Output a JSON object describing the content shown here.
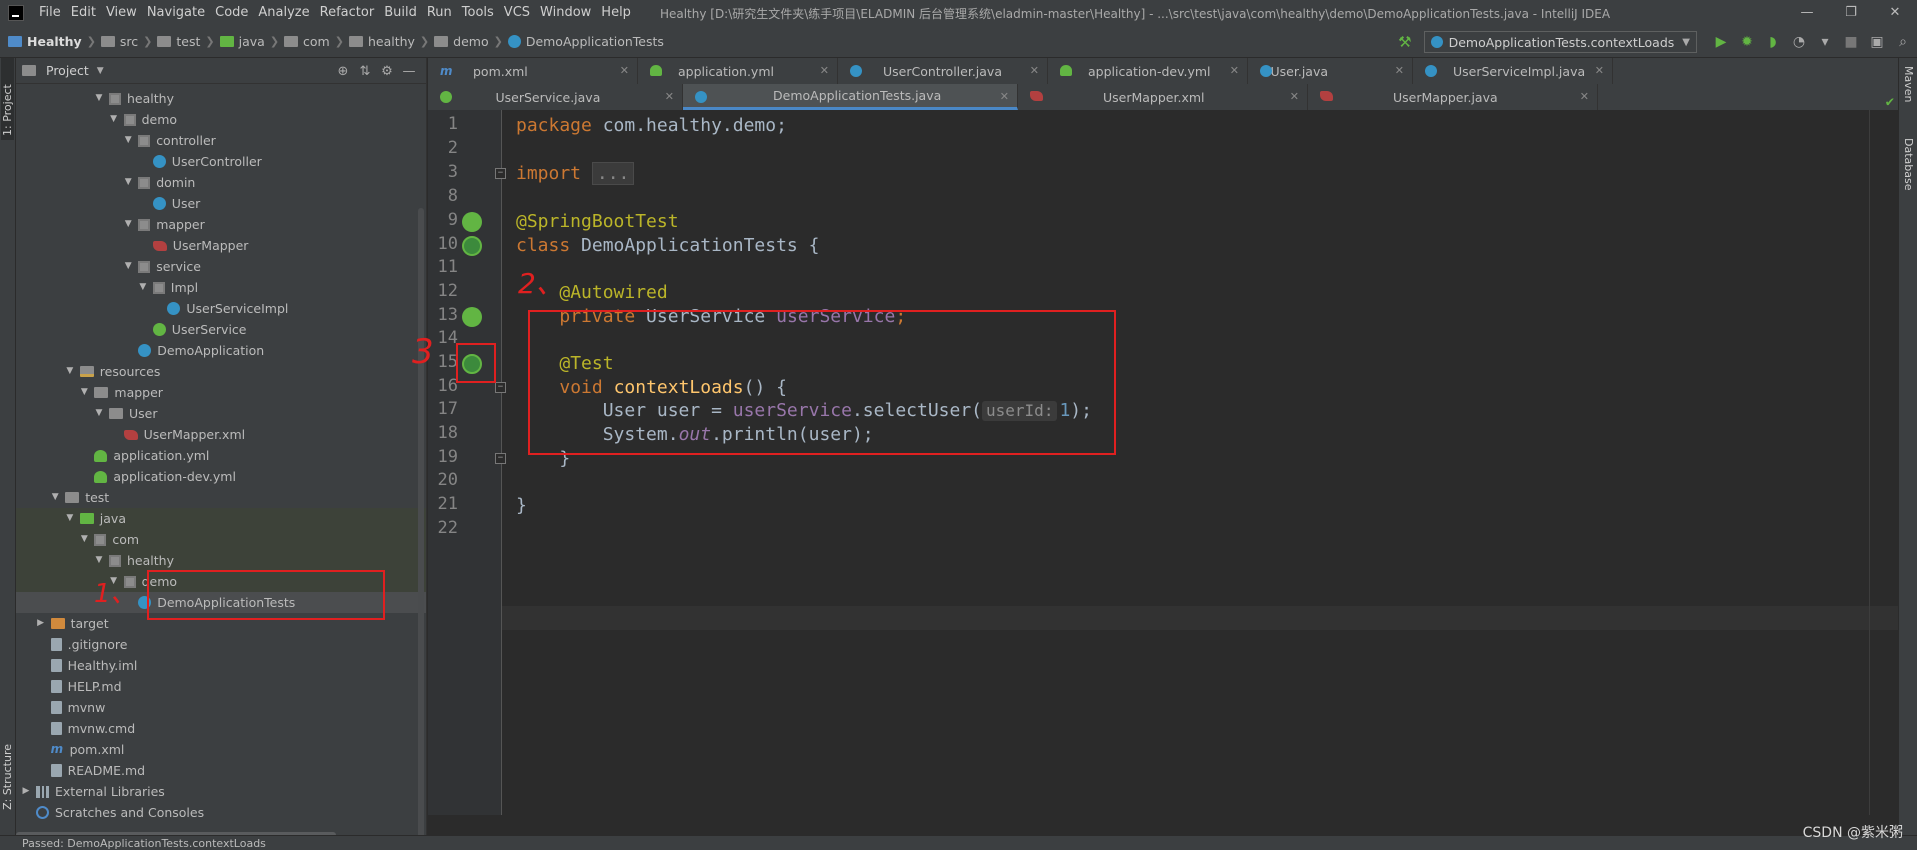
{
  "menubar": {
    "items": [
      "File",
      "Edit",
      "View",
      "Navigate",
      "Code",
      "Analyze",
      "Refactor",
      "Build",
      "Run",
      "Tools",
      "VCS",
      "Window",
      "Help"
    ],
    "window_title": "Healthy [D:\\研究生文件夹\\练手项目\\ELADMIN 后台管理系统\\eladmin-master\\Healthy] - ...\\src\\test\\java\\com\\healthy\\demo\\DemoApplicationTests.java - IntelliJ IDEA",
    "controls": [
      "—",
      "❐",
      "✕"
    ]
  },
  "navbar": {
    "breadcrumbs": [
      "Healthy",
      "src",
      "test",
      "java",
      "com",
      "healthy",
      "demo",
      "DemoApplicationTests"
    ],
    "run_config": "DemoApplicationTests.contextLoads"
  },
  "left_stripe": {
    "project": "1: Project",
    "structure": "Z: Structure"
  },
  "right_stripe": {
    "maven": "Maven",
    "database": "Database"
  },
  "project_panel": {
    "title": "Project",
    "tree": [
      {
        "label": "healthy",
        "icon": "package",
        "level": 5,
        "arrow": "down"
      },
      {
        "label": "demo",
        "icon": "package",
        "level": 6,
        "arrow": "down"
      },
      {
        "label": "controller",
        "icon": "package",
        "level": 7,
        "arrow": "down"
      },
      {
        "label": "UserController",
        "icon": "class",
        "level": 8,
        "arrow": ""
      },
      {
        "label": "domin",
        "icon": "package",
        "level": 7,
        "arrow": "down"
      },
      {
        "label": "User",
        "icon": "class",
        "level": 8,
        "arrow": ""
      },
      {
        "label": "mapper",
        "icon": "package",
        "level": 7,
        "arrow": "down"
      },
      {
        "label": "UserMapper",
        "icon": "mybatis",
        "level": 8,
        "arrow": ""
      },
      {
        "label": "service",
        "icon": "package",
        "level": 7,
        "arrow": "down"
      },
      {
        "label": "Impl",
        "icon": "package",
        "level": 8,
        "arrow": "down"
      },
      {
        "label": "UserServiceImpl",
        "icon": "class",
        "level": 9,
        "arrow": ""
      },
      {
        "label": "UserService",
        "icon": "interface",
        "level": 8,
        "arrow": ""
      },
      {
        "label": "DemoApplication",
        "icon": "class",
        "level": 7,
        "arrow": ""
      },
      {
        "label": "resources",
        "icon": "folder-res",
        "level": 3,
        "arrow": "down"
      },
      {
        "label": "mapper",
        "icon": "folder",
        "level": 4,
        "arrow": "down"
      },
      {
        "label": "User",
        "icon": "folder",
        "level": 5,
        "arrow": "down"
      },
      {
        "label": "UserMapper.xml",
        "icon": "mybatis",
        "level": 6,
        "arrow": ""
      },
      {
        "label": "application.yml",
        "icon": "yml",
        "level": 4,
        "arrow": ""
      },
      {
        "label": "application-dev.yml",
        "icon": "yml",
        "level": 4,
        "arrow": ""
      },
      {
        "label": "test",
        "icon": "folder",
        "level": 2,
        "arrow": "down"
      },
      {
        "label": "java",
        "icon": "folder-test",
        "level": 3,
        "arrow": "down"
      },
      {
        "label": "com",
        "icon": "package",
        "level": 4,
        "arrow": "down"
      },
      {
        "label": "healthy",
        "icon": "package",
        "level": 5,
        "arrow": "down"
      },
      {
        "label": "demo",
        "icon": "package",
        "level": 6,
        "arrow": "down"
      },
      {
        "label": "DemoApplicationTests",
        "icon": "class",
        "level": 7,
        "arrow": "",
        "selected": true
      },
      {
        "label": "target",
        "icon": "folder-target",
        "level": 1,
        "arrow": "right"
      },
      {
        "label": ".gitignore",
        "icon": "file",
        "level": 1,
        "arrow": ""
      },
      {
        "label": "Healthy.iml",
        "icon": "file",
        "level": 1,
        "arrow": ""
      },
      {
        "label": "HELP.md",
        "icon": "file",
        "level": 1,
        "arrow": ""
      },
      {
        "label": "mvnw",
        "icon": "file",
        "level": 1,
        "arrow": ""
      },
      {
        "label": "mvnw.cmd",
        "icon": "file",
        "level": 1,
        "arrow": ""
      },
      {
        "label": "pom.xml",
        "icon": "maven",
        "level": 1,
        "arrow": ""
      },
      {
        "label": "README.md",
        "icon": "file",
        "level": 1,
        "arrow": ""
      },
      {
        "label": "External Libraries",
        "icon": "library",
        "level": 0,
        "arrow": "right"
      },
      {
        "label": "Scratches and Consoles",
        "icon": "scratch",
        "level": 0,
        "arrow": ""
      }
    ]
  },
  "tabs": {
    "row1": [
      {
        "label": "pom.xml",
        "icon": "maven"
      },
      {
        "label": "application.yml",
        "icon": "yml"
      },
      {
        "label": "UserController.java",
        "icon": "class"
      },
      {
        "label": "application-dev.yml",
        "icon": "yml"
      },
      {
        "label": "User.java",
        "icon": "class"
      },
      {
        "label": "UserServiceImpl.java",
        "icon": "class"
      }
    ],
    "row2": [
      {
        "label": "UserService.java",
        "icon": "interface"
      },
      {
        "label": "DemoApplicationTests.java",
        "icon": "class",
        "active": true
      },
      {
        "label": "UserMapper.xml",
        "icon": "mybatis"
      },
      {
        "label": "UserMapper.java",
        "icon": "mybatis"
      }
    ]
  },
  "editor": {
    "lines": [
      {
        "n": "1",
        "text": "package com.healthy.demo;"
      },
      {
        "n": "2",
        "text": ""
      },
      {
        "n": "3",
        "text": "import ..."
      },
      {
        "n": "8",
        "text": ""
      },
      {
        "n": "9",
        "text": "@SpringBootTest"
      },
      {
        "n": "10",
        "text": "class DemoApplicationTests {"
      },
      {
        "n": "11",
        "text": ""
      },
      {
        "n": "12",
        "text": "    @Autowired"
      },
      {
        "n": "13",
        "text": "    private UserService userService;"
      },
      {
        "n": "14",
        "text": ""
      },
      {
        "n": "15",
        "text": "    @Test"
      },
      {
        "n": "16",
        "text": "    void contextLoads() {"
      },
      {
        "n": "17",
        "text": "        User user = userService.selectUser(userId: 1);"
      },
      {
        "n": "18",
        "text": "        System.out.println(user);"
      },
      {
        "n": "19",
        "text": "    }"
      },
      {
        "n": "20",
        "text": ""
      },
      {
        "n": "21",
        "text": "}"
      },
      {
        "n": "22",
        "text": ""
      }
    ],
    "tokens": {
      "package_kw": "package",
      "package_name": " com.healthy.demo;",
      "import_kw": "import",
      "import_fold": "...",
      "ann_springboot": "@SpringBootTest",
      "class_kw": "class",
      "class_name": " DemoApplicationTests {",
      "ann_autowired": "@Autowired",
      "private_kw": "private",
      "field_type": " UserService ",
      "field_name": "userService",
      "semi": ";",
      "ann_test": "@Test",
      "void_kw": "void",
      "method_name": "contextLoads",
      "method_tail": "() {",
      "l17_a": "User user = ",
      "l17_field": "userService",
      "l17_b": ".selectUser(",
      "l17_hint": "userId:",
      "l17_num": "1",
      "l17_c": ");",
      "l18_a": "System.",
      "l18_out": "out",
      "l18_b": ".println(user);",
      "close_inner": "}",
      "close_outer": "}"
    }
  },
  "annotations": {
    "mark1": "1、",
    "mark2": "2、",
    "mark3": "3"
  },
  "statusbar": {
    "text": "Passed: DemoApplicationTests.contextLoads"
  },
  "watermark": "CSDN @紫米粥",
  "colors": {
    "accent": "#4a88c7",
    "annotation_red": "#e02020",
    "spring_green": "#62b543"
  }
}
